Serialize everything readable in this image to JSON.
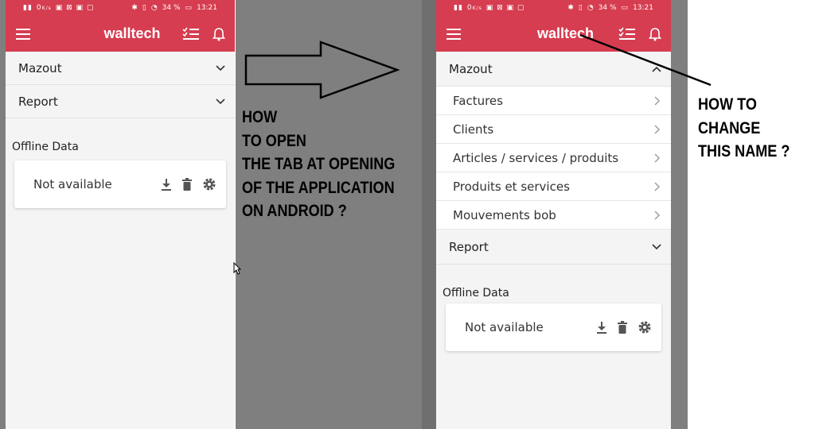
{
  "colors": {
    "primary": "#d63d50",
    "panel_bg": "#f4f4f4",
    "gray_bg": "#7f7f7f"
  },
  "status_bar": {
    "net_speed_value": "0",
    "net_speed_unit": "K/s",
    "battery": "34 %",
    "time": "13:21"
  },
  "app": {
    "title": "walltech",
    "menu_icon": "hamburger-icon",
    "tasks_icon": "checklist-icon",
    "bell_icon": "bell-icon"
  },
  "left_screen": {
    "accordion": [
      {
        "label": "Mazout",
        "state": "collapsed"
      },
      {
        "label": "Report",
        "state": "collapsed"
      }
    ],
    "offline_label": "Offline Data",
    "offline_card": {
      "text": "Not available"
    }
  },
  "right_screen": {
    "accordion": [
      {
        "label": "Mazout",
        "state": "expanded",
        "items": [
          "Factures",
          "Clients",
          "Articles / services / produits",
          "Produits et services",
          "Mouvements bob"
        ]
      },
      {
        "label": "Report",
        "state": "collapsed"
      }
    ],
    "offline_label": "Offline Data",
    "offline_card": {
      "text": "Not available"
    }
  },
  "annotations": {
    "question_left": [
      "HOW",
      "TO OPEN",
      "THE TAB AT OPENING",
      "OF THE APPLICATION",
      "ON ANDROID ?"
    ],
    "question_right": [
      "HOW TO",
      "CHANGE",
      "THIS NAME ?"
    ]
  }
}
